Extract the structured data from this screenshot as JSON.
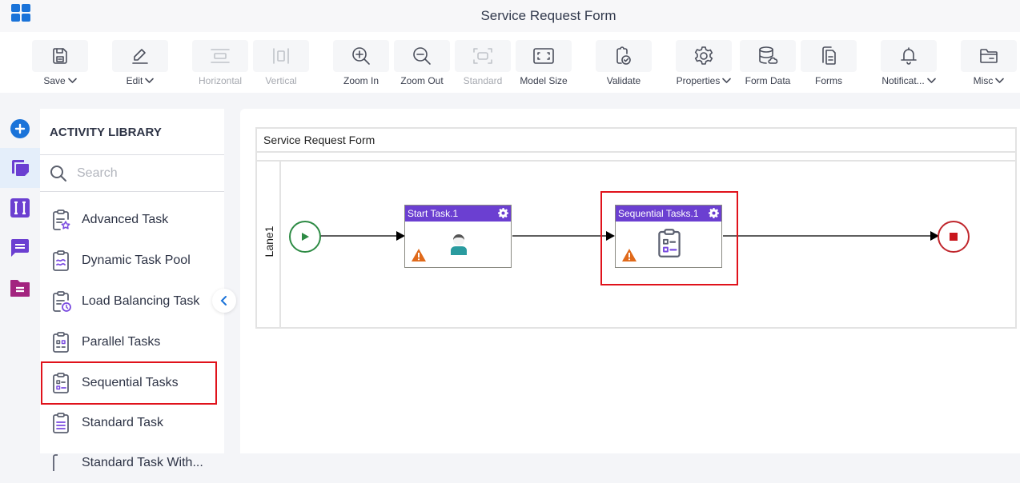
{
  "header": {
    "title": "Service Request Form",
    "app_icon": "app-grid-icon"
  },
  "toolbar": {
    "buttons": [
      {
        "id": "save",
        "label": "Save",
        "icon": "save-icon",
        "has_dropdown": true,
        "enabled": true
      },
      {
        "id": "edit",
        "label": "Edit",
        "icon": "edit-pencil-icon",
        "has_dropdown": true,
        "enabled": true
      },
      {
        "id": "horizontal",
        "label": "Horizontal",
        "icon": "horizontal-layout-icon",
        "has_dropdown": false,
        "enabled": false
      },
      {
        "id": "vertical",
        "label": "Vertical",
        "icon": "vertical-layout-icon",
        "has_dropdown": false,
        "enabled": false
      },
      {
        "id": "zoom-in",
        "label": "Zoom In",
        "icon": "zoom-in-icon",
        "has_dropdown": false,
        "enabled": true
      },
      {
        "id": "zoom-out",
        "label": "Zoom Out",
        "icon": "zoom-out-icon",
        "has_dropdown": false,
        "enabled": true
      },
      {
        "id": "standard",
        "label": "Standard",
        "icon": "standard-size-icon",
        "has_dropdown": false,
        "enabled": false
      },
      {
        "id": "model-size",
        "label": "Model Size",
        "icon": "model-size-icon",
        "has_dropdown": false,
        "enabled": true
      },
      {
        "id": "validate",
        "label": "Validate",
        "icon": "validate-icon",
        "has_dropdown": false,
        "enabled": true
      },
      {
        "id": "properties",
        "label": "Properties",
        "icon": "gear-icon",
        "has_dropdown": true,
        "enabled": true
      },
      {
        "id": "form-data",
        "label": "Form Data",
        "icon": "database-icon",
        "has_dropdown": false,
        "enabled": true
      },
      {
        "id": "forms",
        "label": "Forms",
        "icon": "forms-icon",
        "has_dropdown": false,
        "enabled": true
      },
      {
        "id": "notifications",
        "label": "Notificat...",
        "icon": "bell-icon",
        "has_dropdown": true,
        "enabled": true
      },
      {
        "id": "misc",
        "label": "Misc",
        "icon": "folder-icon",
        "has_dropdown": true,
        "enabled": true
      }
    ]
  },
  "left_rail": {
    "items": [
      {
        "id": "add",
        "icon": "add-circle-icon",
        "color": "#1a73d9",
        "active": false
      },
      {
        "id": "activity-library",
        "icon": "activity-library-icon",
        "color": "#6b3fd1",
        "active": true
      },
      {
        "id": "variables",
        "icon": "variables-icon",
        "color": "#6b3fd1",
        "active": false
      },
      {
        "id": "messages",
        "icon": "chat-icon",
        "color": "#6b3fd1",
        "active": false
      },
      {
        "id": "documents",
        "icon": "document-folder-icon",
        "color": "#a3247f",
        "active": false
      }
    ]
  },
  "library": {
    "title": "ACTIVITY LIBRARY",
    "search_placeholder": "Search",
    "search_value": "",
    "items": [
      {
        "label": "Advanced Task",
        "icon": "advanced-task-icon",
        "selected": false
      },
      {
        "label": "Dynamic Task Pool",
        "icon": "dynamic-task-pool-icon",
        "selected": false
      },
      {
        "label": "Load Balancing Task",
        "icon": "load-balancing-task-icon",
        "selected": false
      },
      {
        "label": "Parallel Tasks",
        "icon": "parallel-tasks-icon",
        "selected": false
      },
      {
        "label": "Sequential Tasks",
        "icon": "sequential-tasks-icon",
        "selected": true
      },
      {
        "label": "Standard Task",
        "icon": "standard-task-icon",
        "selected": false
      },
      {
        "label": "Standard Task With...",
        "icon": "standard-task-icon",
        "selected": false
      }
    ]
  },
  "canvas": {
    "pool_title": "Service Request Form",
    "lane_label": "Lane1",
    "start_event": {
      "type": "start",
      "color": "#2e8b45"
    },
    "end_event": {
      "type": "end",
      "color": "#c0272d"
    },
    "tasks": [
      {
        "label": "Start Task.1",
        "icon": "user-icon",
        "has_warning": true,
        "highlighted": false
      },
      {
        "label": "Sequential Tasks.1",
        "icon": "sequential-tasks-icon",
        "has_warning": true,
        "highlighted": true
      }
    ],
    "colors": {
      "task_header": "#6b3fd1",
      "warning": "#e06a1b",
      "highlight": "#e0121b"
    }
  }
}
